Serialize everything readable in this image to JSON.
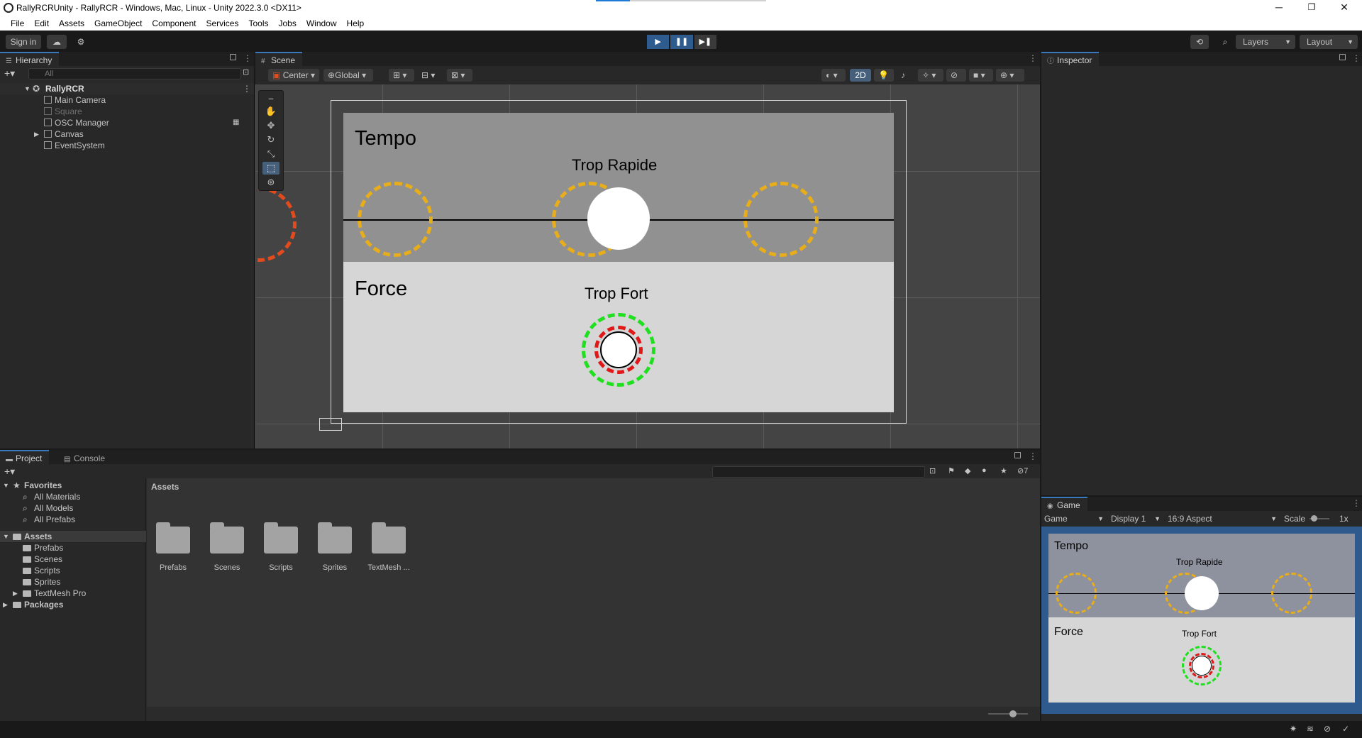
{
  "window": {
    "title": "RallyRCRUnity - RallyRCR - Windows, Mac, Linux - Unity 2022.3.0 <DX11>",
    "minimize": "─",
    "maximize": "❐",
    "close": "✕"
  },
  "menu": [
    "File",
    "Edit",
    "Assets",
    "GameObject",
    "Component",
    "Services",
    "Tools",
    "Jobs",
    "Window",
    "Help"
  ],
  "toolbar": {
    "sign_in": "Sign in",
    "layers": "Layers",
    "layout": "Layout",
    "play": "▶",
    "pause": "❚❚",
    "step": "▶❚"
  },
  "hierarchy": {
    "tab": "Hierarchy",
    "search_placeholder": "All",
    "scene": "RallyRCR",
    "items": [
      "Main Camera",
      "Square",
      "OSC Manager",
      "Canvas",
      "EventSystem"
    ]
  },
  "scene": {
    "tab": "Scene",
    "pivot": "Center",
    "space": "Global",
    "mode_2d": "2D"
  },
  "inspector": {
    "tab": "Inspector"
  },
  "canvas_ui": {
    "tempo_label": "Tempo",
    "tempo_status": "Trop Rapide",
    "force_label": "Force",
    "force_status": "Trop Fort"
  },
  "project": {
    "tab_project": "Project",
    "tab_console": "Console",
    "favorites_label": "Favorites",
    "favorites": [
      "All Materials",
      "All Models",
      "All Prefabs"
    ],
    "assets_label": "Assets",
    "asset_folders": [
      "Prefabs",
      "Scenes",
      "Scripts",
      "Sprites",
      "TextMesh Pro"
    ],
    "packages_label": "Packages",
    "breadcrumb": "Assets",
    "grid_items": [
      "Prefabs",
      "Scenes",
      "Scripts",
      "Sprites",
      "TextMesh ..."
    ],
    "hidden_count": "7"
  },
  "game": {
    "tab": "Game",
    "mode": "Game",
    "display": "Display 1",
    "aspect": "16:9 Aspect",
    "scale_label": "Scale",
    "scale_value": "1x"
  },
  "colors": {
    "accent": "#2f5c8f",
    "ring_orange": "#e8ad1a",
    "ring_red_orange": "#e44b1c",
    "ring_green": "#1ee01e",
    "ring_red": "#e01818"
  }
}
